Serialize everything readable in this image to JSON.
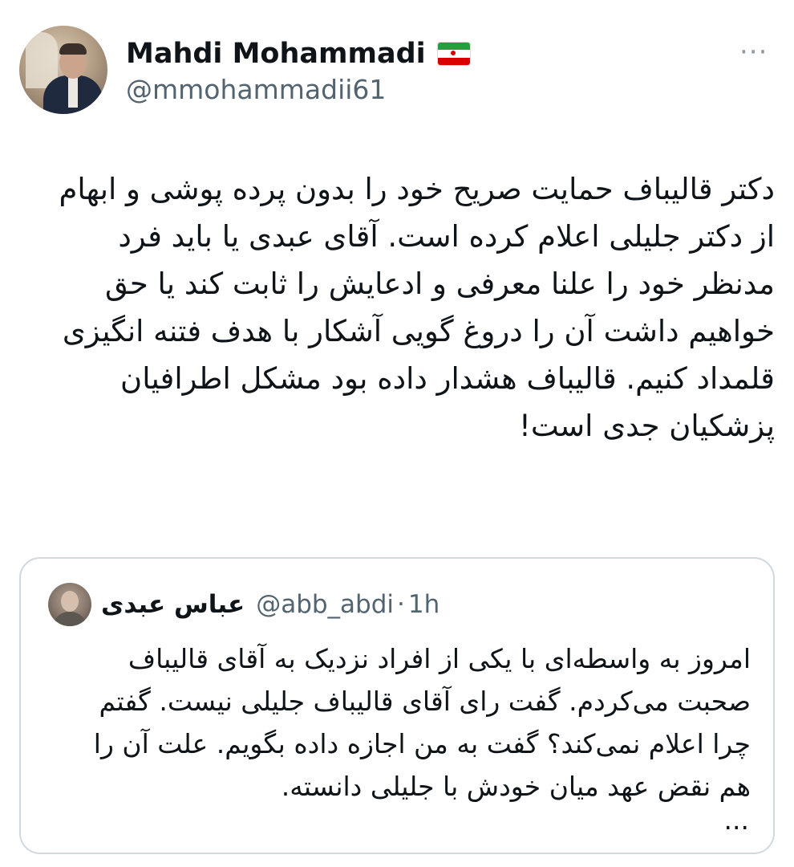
{
  "author": {
    "name": "Mahdi Mohammadi",
    "flag_icon": "iran-flag-icon",
    "handle": "@mmohammadii61",
    "more_icon": "more-options-icon",
    "more_glyph": "···"
  },
  "tweet": {
    "text": "دکتر قالیباف حمایت صریح خود را بدون پرده پوشی و ابهام\nاز دکتر جلیلی اعلام کرده است. آقای عبدی یا باید فرد\nمدنظر خود را علنا معرفی و ادعایش را ثابت کند یا حق\nخواهیم داشت آن را دروغ گویی آشکار با هدف فتنه انگیزی\nقلمداد کنیم. قالیباف هشدار داده بود مشکل اطرافیان\nپزشکیان جدی است!"
  },
  "quoted": {
    "name": "عباس عبدی",
    "handle": "@abb_abdi",
    "separator": "·",
    "time": "1h",
    "text": "امروز به واسطه‌ای با یکی از افراد نزدیک به آقای قالیباف\nصحبت می‌کردم. گفت رای آقای قالیباف جلیلی نیست. گفتم\nچرا اعلام نمی‌کند؟ گفت به من اجازه داده بگویم. علت آن را\nهم نقض عهد میان خودش با جلیلی دانسته.",
    "ellipsis": "..."
  },
  "colors": {
    "text": "#0f1419",
    "secondary": "#536471",
    "border": "#cfd9de"
  }
}
